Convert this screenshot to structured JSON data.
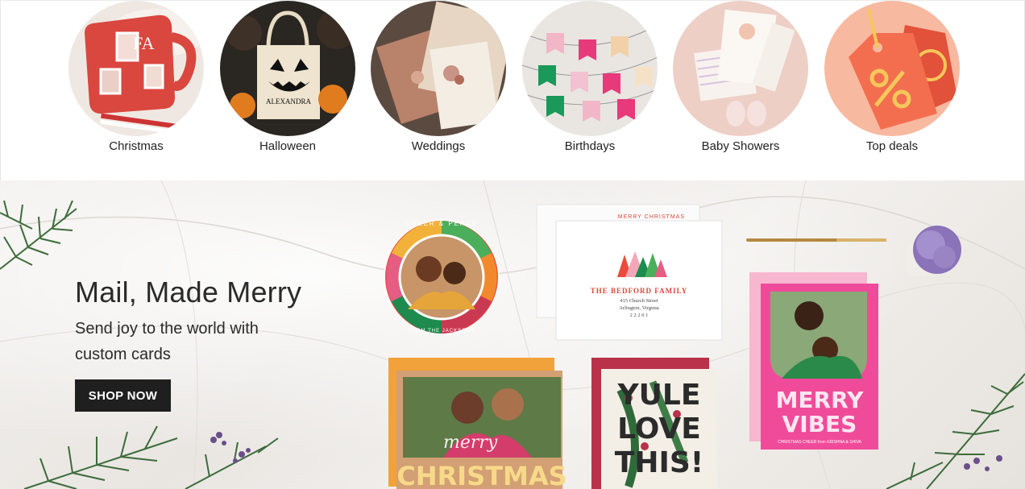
{
  "categories": [
    {
      "label": "Christmas",
      "icon": "christmas-mug-image"
    },
    {
      "label": "Halloween",
      "icon": "halloween-tote-image"
    },
    {
      "label": "Weddings",
      "icon": "wedding-invitation-image"
    },
    {
      "label": "Birthdays",
      "icon": "birthday-banner-image"
    },
    {
      "label": "Baby Showers",
      "icon": "baby-shower-card-image"
    },
    {
      "label": "Top deals",
      "icon": "price-tag-image"
    }
  ],
  "hero": {
    "title": "Mail, Made Merry",
    "subtitle": "Send joy to the world with custom cards",
    "cta": "SHOP NOW"
  },
  "product_text": {
    "mug_letters": "FA",
    "tote_name": "ALEXANDRA",
    "round_card_top": "CHEER & PEACE",
    "round_card_bottom": "FROM THE JACKSONS",
    "envelope_back_label": "MERRY CHRISTMAS",
    "envelope_family": "THE BEDFORD FAMILY",
    "envelope_street": "415 Church Street",
    "envelope_city": "Arlington, Virginia",
    "envelope_zip": "2 2 2 0 1",
    "merry_script": "merry",
    "christmas_card": "CHRISTMAS",
    "yule_line1": "YULE",
    "yule_line2": "LOVE",
    "yule_line3": "THIS!",
    "vibes_line1": "MERRY",
    "vibes_line2": "VIBES",
    "vibes_footer": "CHRISTMAS CHEER from KRISHNA & SHIVA"
  },
  "colors": {
    "cta_bg": "#1f1f1f",
    "pink_card": "#f04b9a",
    "top_deals_bg": "#f7b9a0"
  }
}
